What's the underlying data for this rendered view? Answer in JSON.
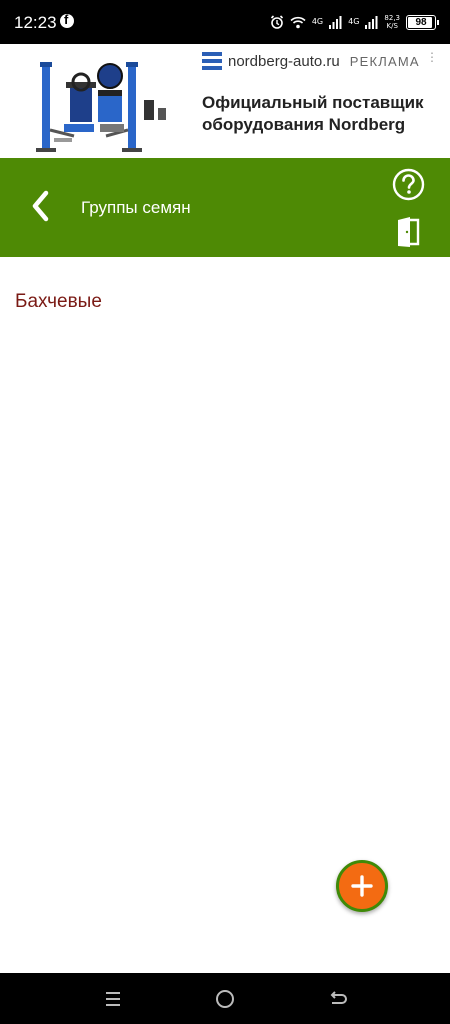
{
  "status_bar": {
    "time": "12:23",
    "network_1": "4G",
    "network_2": "4G",
    "speed_value": "82,3",
    "speed_unit": "K/S",
    "battery": "98"
  },
  "ad": {
    "domain": "nordberg-auto.ru",
    "tag": "РЕКЛАМА",
    "more": "⋮",
    "headline": "Официальный поставщик оборудования Nordberg"
  },
  "app_bar": {
    "title": "Группы семян",
    "background": "#4e8a05"
  },
  "list": {
    "items": [
      {
        "label": "Бахчевые"
      }
    ]
  },
  "colors": {
    "accent": "#f36b12",
    "item_text": "#7a1a14",
    "brand_green": "#4e8a05"
  }
}
